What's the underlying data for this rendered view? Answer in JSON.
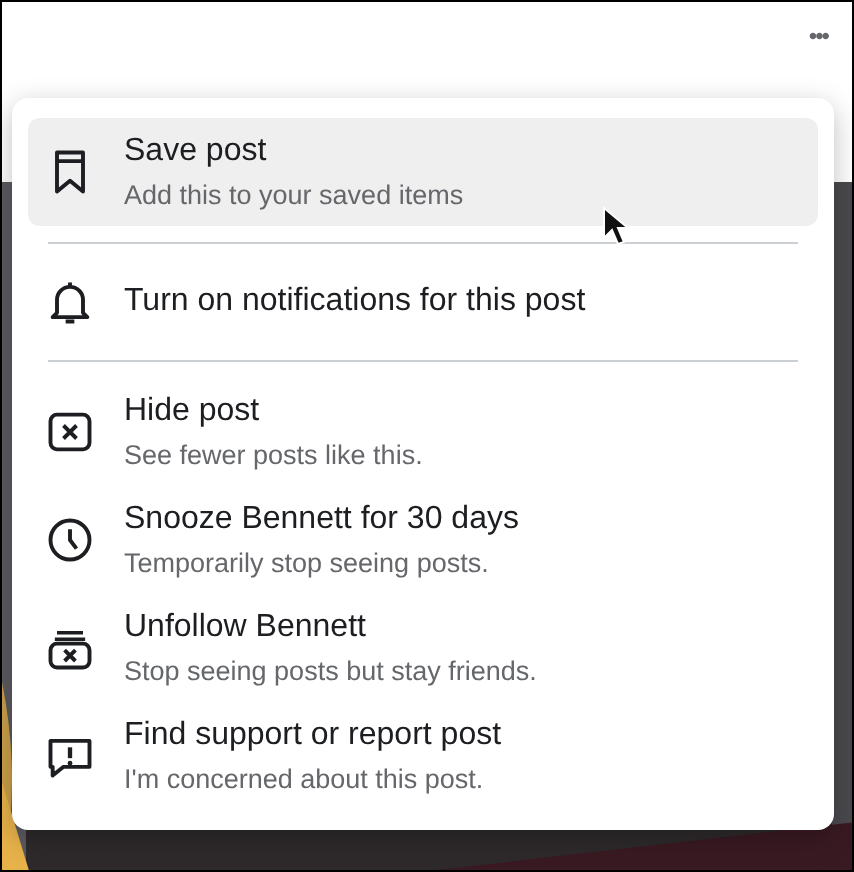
{
  "more_button": {
    "label": "•••"
  },
  "menu": {
    "groups": [
      {
        "items": [
          {
            "kind": "bookmark",
            "title": "Save post",
            "subtitle": "Add this to your saved items",
            "highlighted": true
          }
        ]
      },
      {
        "items": [
          {
            "kind": "bell",
            "title": "Turn on notifications for this post",
            "highlighted": false
          }
        ]
      },
      {
        "items": [
          {
            "kind": "hide",
            "title": "Hide post",
            "subtitle": "See fewer posts like this.",
            "highlighted": false
          },
          {
            "kind": "snooze",
            "title": "Snooze Bennett for 30 days",
            "subtitle": "Temporarily stop seeing posts.",
            "highlighted": false
          },
          {
            "kind": "unfollow",
            "title": "Unfollow Bennett",
            "subtitle": "Stop seeing posts but stay friends.",
            "highlighted": false
          },
          {
            "kind": "report",
            "title": "Find support or report post",
            "subtitle": "I'm concerned about this post.",
            "highlighted": false
          }
        ]
      }
    ]
  }
}
